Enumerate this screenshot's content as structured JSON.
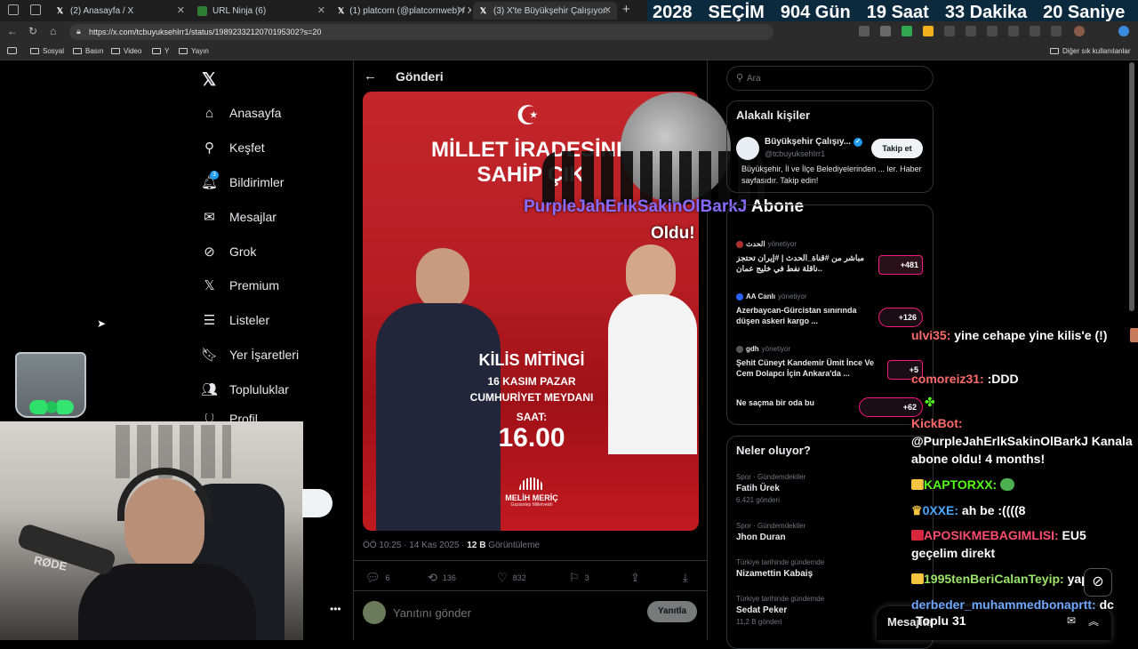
{
  "browser": {
    "tabs": [
      {
        "title": "(2) Anasayfa / X"
      },
      {
        "title": "URL Ninja (6)"
      },
      {
        "title": "(1) platcorn (@platcornweb) / X"
      },
      {
        "title": "(3) X'te Büyükşehir Çalışıyor: \"CHP...",
        "active": true
      }
    ],
    "new_tab": "+",
    "url": "https://x.com/tcbuyuksehIrr1/status/1989233212070195302?s=20",
    "bookmarks": [
      "Sosyal",
      "Basın",
      "Video",
      "Y",
      "Yayın"
    ],
    "other_bookmarks": "Diğer sık kullanılanlar"
  },
  "countdown": {
    "year": "2028",
    "label": "SEÇİM",
    "days": "904 Gün",
    "hours": "19 Saat",
    "minutes": "33 Dakika",
    "seconds": "20 Saniye"
  },
  "nav": {
    "items": [
      "Anasayfa",
      "Keşfet",
      "Bildirimler",
      "Mesajlar",
      "Grok",
      "Premium",
      "Listeler",
      "Yer İşaretleri",
      "Topluluklar",
      "Profil"
    ],
    "notif_count": "3"
  },
  "post": {
    "header": "Gönderi",
    "poster": {
      "headline1": "MİLLET İRADESİNE",
      "headline2": "SAHİP ÇIK",
      "event": "KİLİS MİTİNGİ",
      "date": "16 KASIM PAZAR",
      "venue": "CUMHURİYET MEYDANI",
      "time_label": "SAAT:",
      "time": "16.00",
      "sponsor": "MELİH MERİÇ",
      "sponsor_sub": "Gaziantep Milletvekili"
    },
    "timestamp": "ÖÖ 10:25 · 14 Kas 2025 · ",
    "views": "12 B",
    "views_label": " Görüntüleme",
    "replies": "6",
    "reposts": "136",
    "likes": "832",
    "bookmarks": "3",
    "reply_placeholder": "Yanıtını gönder",
    "reply_button": "Yanıtla"
  },
  "search": {
    "placeholder": "Ara"
  },
  "related": {
    "title": "Alakalı kişiler",
    "name": "Büyükşehir Çalışıy...",
    "handle": "@tcbuyuksehIrr1",
    "bio": "Büyükşehir, İl ve İlçe Belediyelerinden ... ler. Haber sayfasıdır. Takip edin!",
    "follow": "Takip et"
  },
  "spaces": [
    {
      "host": "الحدث",
      "role": "yönetiyor",
      "title": "مباشر من #قناة_الحدث | #إيران تحتجز ناقلة نفط في خليج عمان..",
      "count": "+481"
    },
    {
      "host": "AA Canlı",
      "role": "yönetiyor",
      "title": "Azerbaycan-Gürcistan sınırında düşen askeri kargo ...",
      "count": "+126"
    },
    {
      "host": "gdh",
      "role": "yönetiyor",
      "title": "Şehit Cüneyt Kandemir Ümit İnce Ve Cem Dolapcı İçin Ankara'da ...",
      "count": "+5"
    },
    {
      "host": "",
      "role": "",
      "title": "Ne saçma bir oda bu",
      "count": "+62"
    }
  ],
  "trends": {
    "title": "Neler oluyor?",
    "items": [
      {
        "cat": "Spor · Gündemdekiler",
        "name": "Fatih Ürek",
        "count": "6.421 gönderi"
      },
      {
        "cat": "Spor · Gündemdekiler",
        "name": "Jhon Duran",
        "count": ""
      },
      {
        "cat": "Türkiye tarihinde gündemde",
        "name": "Nizamettin Kabaiş",
        "count": ""
      },
      {
        "cat": "Türkiye tarihinde gündemde",
        "name": "Sedat Peker",
        "count": "11,2 B gönderi"
      }
    ]
  },
  "messages": {
    "label": "Mesajlar"
  },
  "overlay": {
    "alert_name": "PurpleJahErlkSakinOlBarkJ",
    "alert_text": " Abone",
    "alert_text2": "Oldu!",
    "total": "Toplu 31",
    "chat": [
      {
        "user": "ulvi35:",
        "msg": " yine cehape yine kilis'e (!)",
        "color": "#ff6b6b"
      },
      {
        "user": "comoreiz31:",
        "msg": " :DDD",
        "color": "#ff6b6b"
      },
      {
        "user": "KickBot:",
        "msg": " @PurpleJahErlkSakinOlBarkJ Kanala abone oldu! 4 months!",
        "color": "#ff6b6b"
      },
      {
        "user": "KAPTORXX:",
        "msg": "",
        "color": "#53fc18"
      },
      {
        "user": "0XXE:",
        "msg": " ah be :((((8",
        "color": "#4aa8ff"
      },
      {
        "user": "APOSIKMEBAGIMLISI:",
        "msg": " EU5 geçelim direkt",
        "color": "#ff4d6d"
      },
      {
        "user": "1995tenBeriCalanTeyip:",
        "msg": " yap",
        "color": "#9be46a"
      },
      {
        "user": "derbeder_muhammedbonaprtt:",
        "msg": " dc",
        "color": "#6fa8ff"
      }
    ]
  }
}
